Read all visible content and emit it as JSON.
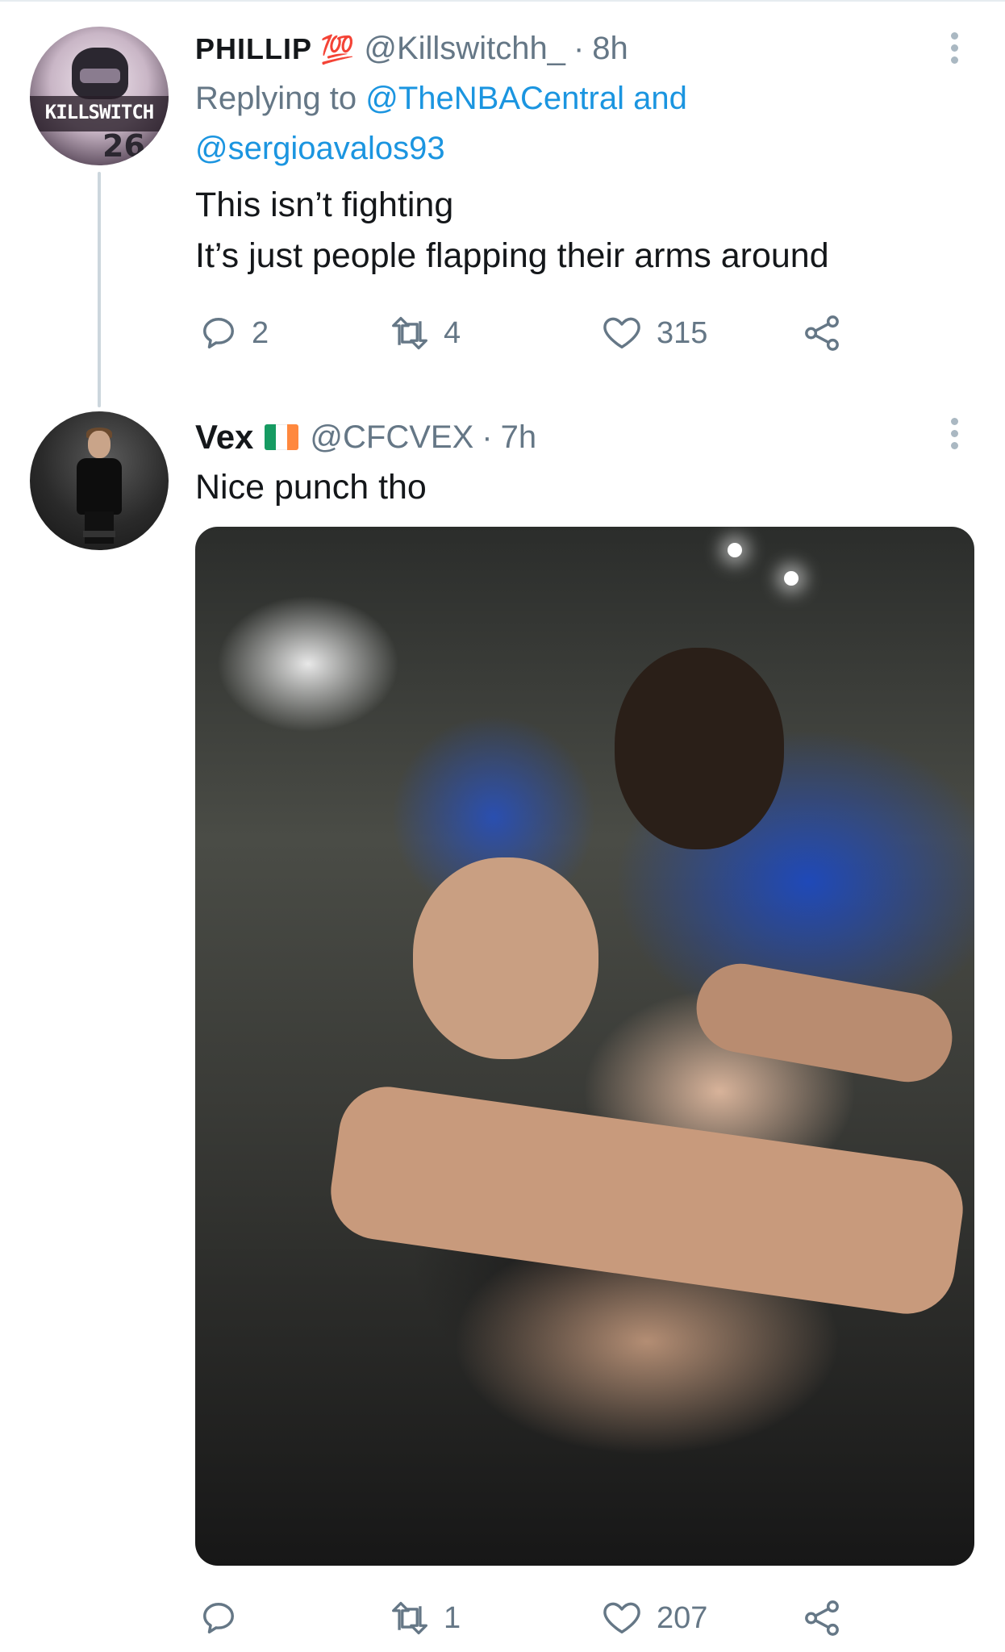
{
  "tweets": [
    {
      "name": "PHILLIP",
      "emoji": "💯",
      "handle": "@Killswitchh_",
      "sep": "·",
      "time": "8h",
      "replying_prefix": "Replying to",
      "replying_to": "@TheNBACentral",
      "replying_and": "and",
      "replying_to_2": "@sergioavalos93",
      "lines": [
        "This isn’t fighting",
        "It’s just people flapping their arms around"
      ],
      "avatar_text": "KILLSWITCH",
      "avatar_number": "26",
      "actions": {
        "reply": "2",
        "retweet": "4",
        "like": "315"
      }
    },
    {
      "name": "Vex",
      "flag_colors": [
        "#169b62",
        "#ffffff",
        "#ff883e"
      ],
      "handle": "@CFCVEX",
      "sep": "·",
      "time": "7h",
      "text": "Nice punch tho",
      "actions": {
        "reply": "",
        "retweet": "1",
        "like": "207"
      }
    }
  ],
  "colors": {
    "link": "#1b95e0",
    "muted": "#657786",
    "text": "#14171a",
    "thread_line": "#ccd6dd"
  },
  "icons": [
    "more-vertical-icon",
    "reply-icon",
    "retweet-icon",
    "like-icon",
    "share-icon"
  ]
}
